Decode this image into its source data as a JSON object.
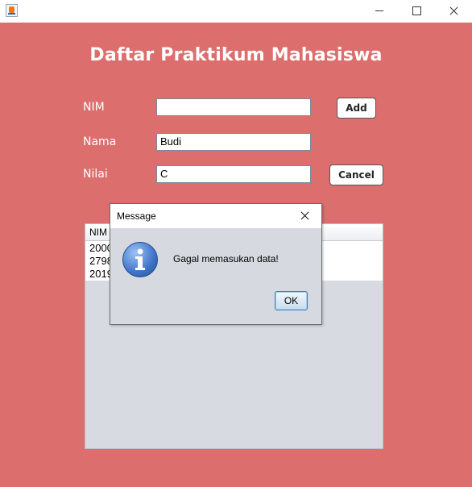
{
  "window": {
    "controls": {
      "minimize_icon": "minimize-icon",
      "maximize_icon": "maximize-icon",
      "close_icon": "close-icon"
    },
    "app_icon": "java-cup-icon"
  },
  "form": {
    "title": "Daftar Praktikum Mahasiswa",
    "nim_label": "NIM",
    "nim_value": "",
    "nama_label": "Nama",
    "nama_value": "Budi",
    "nilai_label": "Nilai",
    "nilai_value": "C",
    "add_label": "Add",
    "cancel_label": "Cancel"
  },
  "table": {
    "columns": [
      "NIM"
    ],
    "rows": [
      [
        "2000"
      ],
      [
        "2798"
      ],
      [
        "2019"
      ]
    ]
  },
  "dialog": {
    "title": "Message",
    "message": "Gagal memasukan data!",
    "ok_label": "OK",
    "icon": "info-icon"
  },
  "colors": {
    "background": "#dd6e6e",
    "panel": "#d7dae1",
    "dialog": "#d6d9df"
  }
}
